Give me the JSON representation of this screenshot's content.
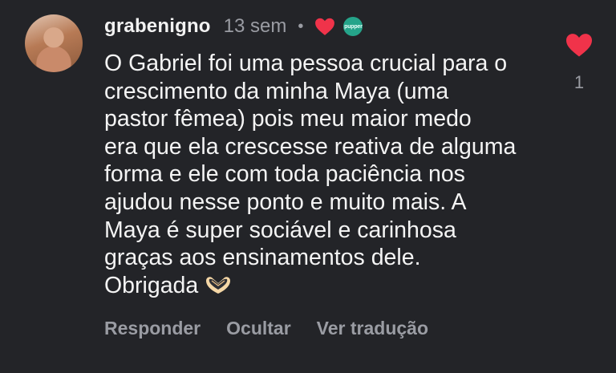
{
  "comment": {
    "username": "grabenigno",
    "time": "13 sem",
    "separator": "•",
    "badge_text": "pupper",
    "lines": [
      "O Gabriel foi uma pessoa crucial para o",
      "crescimento da minha Maya (uma",
      "pastor fêmea) pois meu maior medo",
      "era que ela crescesse reativa de alguma",
      "forma e ele com toda paciência nos",
      "ajudou nesse ponto e muito mais. A",
      "Maya é super sociável e carinhosa",
      "graças aos ensinamentos dele.",
      "Obrigada"
    ],
    "emoji_icon": "heart-hands-icon",
    "actions": {
      "reply": "Responder",
      "hide": "Ocultar",
      "translate": "Ver tradução"
    },
    "like_count": "1"
  },
  "colors": {
    "background": "#232428",
    "text": "#f4f4f4",
    "muted": "#9a9ca3",
    "heart": "#f0334a",
    "badge": "#25a48a"
  }
}
